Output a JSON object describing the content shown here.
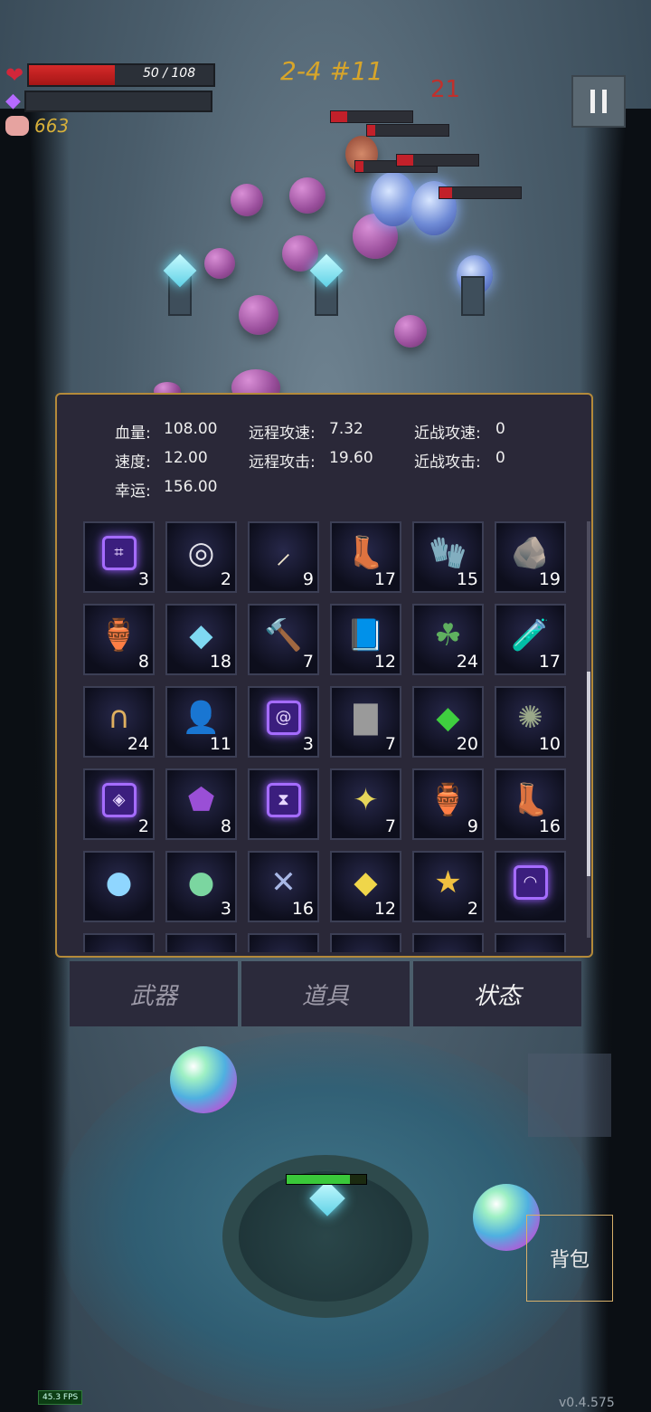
{
  "hud": {
    "hp_text": "50 / 108",
    "hp_current": 50,
    "hp_max": 108,
    "gold": "663",
    "stage": "2-4 #11",
    "combo": "21",
    "colors": {
      "hp": "#d62a2a",
      "gold": "#d7b03a",
      "stage": "#d7a52a",
      "combo": "#c0302c"
    }
  },
  "stats": {
    "hp_label": "血量:",
    "hp_value": "108.00",
    "ranged_speed_label": "远程攻速:",
    "ranged_speed_value": "7.32",
    "melee_speed_label": "近战攻速:",
    "melee_speed_value": "0",
    "speed_label": "速度:",
    "speed_value": "12.00",
    "ranged_attack_label": "远程攻击:",
    "ranged_attack_value": "19.60",
    "melee_attack_label": "近战攻击:",
    "melee_attack_value": "0",
    "luck_label": "幸运:",
    "luck_value": "156.00"
  },
  "items": [
    {
      "icon": "rune-cross-icon",
      "glyph": "⌗",
      "count": "3",
      "rune": true
    },
    {
      "icon": "ring-icon",
      "glyph": "◎",
      "count": "2"
    },
    {
      "icon": "horn-icon",
      "glyph": "⸝",
      "count": "9"
    },
    {
      "icon": "boots-icon",
      "glyph": "👢",
      "count": "17"
    },
    {
      "icon": "gloves-icon",
      "glyph": "🧤",
      "count": "15"
    },
    {
      "icon": "stone-icon",
      "glyph": "🪨",
      "count": "19"
    },
    {
      "icon": "bottle-icon",
      "glyph": "🏺",
      "count": "8"
    },
    {
      "icon": "crystal-icon",
      "glyph": "◆",
      "count": "18"
    },
    {
      "icon": "hammer-icon",
      "glyph": "🔨",
      "count": "7"
    },
    {
      "icon": "book-icon",
      "glyph": "📘",
      "count": "12"
    },
    {
      "icon": "clover-icon",
      "glyph": "☘",
      "count": "24"
    },
    {
      "icon": "potion-icon",
      "glyph": "🧪",
      "count": "17"
    },
    {
      "icon": "horseshoe-icon",
      "glyph": "∩",
      "count": "24"
    },
    {
      "icon": "cloak-icon",
      "glyph": "👤",
      "count": "11"
    },
    {
      "icon": "rune-spiral-icon",
      "glyph": "@",
      "count": "3",
      "rune": true
    },
    {
      "icon": "tombstone-icon",
      "glyph": "▇",
      "count": "7"
    },
    {
      "icon": "emerald-icon",
      "glyph": "◆",
      "count": "20"
    },
    {
      "icon": "octopus-icon",
      "glyph": "✺",
      "count": "10"
    },
    {
      "icon": "rune-eye-icon",
      "glyph": "◈",
      "count": "2",
      "rune": true
    },
    {
      "icon": "shell-icon",
      "glyph": "⬟",
      "count": "8"
    },
    {
      "icon": "rune-hourglass-icon",
      "glyph": "⧗",
      "count": "",
      "rune": true
    },
    {
      "icon": "star-crystal-icon",
      "glyph": "✦",
      "count": "7"
    },
    {
      "icon": "pouch-icon",
      "glyph": "🏺",
      "count": "9"
    },
    {
      "icon": "purple-boots-icon",
      "glyph": "👢",
      "count": "16"
    },
    {
      "icon": "sphere-icon",
      "glyph": "●",
      "count": ""
    },
    {
      "icon": "rainbow-orb-icon",
      "glyph": "●",
      "count": "3"
    },
    {
      "icon": "dragonfly-icon",
      "glyph": "✕",
      "count": "16"
    },
    {
      "icon": "topaz-icon",
      "glyph": "◆",
      "count": "12"
    },
    {
      "icon": "star-trophy-icon",
      "glyph": "★",
      "count": "2"
    },
    {
      "icon": "rune-gauge-icon",
      "glyph": "◠",
      "count": "",
      "rune": true
    }
  ],
  "tabs": {
    "weapons": "武器",
    "items": "道具",
    "status": "状态",
    "active": "status"
  },
  "bag_label": "背包",
  "fps": "45.3 FPS",
  "version": "v0.4.575"
}
